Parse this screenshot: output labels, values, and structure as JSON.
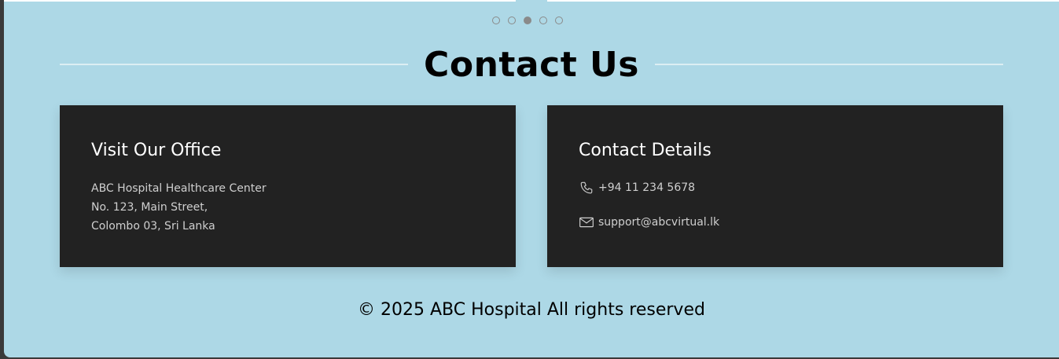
{
  "carousel": {
    "dots": [
      {
        "label": "slide 1",
        "active": false
      },
      {
        "label": "slide 2",
        "active": false
      },
      {
        "label": "slide 3",
        "active": true
      },
      {
        "label": "slide 4",
        "active": false
      },
      {
        "label": "slide 5",
        "active": false
      }
    ]
  },
  "section": {
    "title": "Contact Us"
  },
  "office": {
    "title": "Visit Our Office",
    "lines": [
      "ABC Hospital Healthcare Center",
      "No. 123, Main Street,",
      "Colombo 03, Sri Lanka"
    ]
  },
  "contact": {
    "title": "Contact Details",
    "phone_icon": "phone-icon",
    "phone": "+94 11 234 5678",
    "email_icon": "mail-icon",
    "email": "support@abcvirtual.lk"
  },
  "footer": {
    "text": "© 2025 ABC Hospital All rights reserved"
  },
  "colors": {
    "background": "#add8e6",
    "card": "#222222",
    "card_text": "#cfcfcf",
    "heading_line": "#dceef3"
  }
}
